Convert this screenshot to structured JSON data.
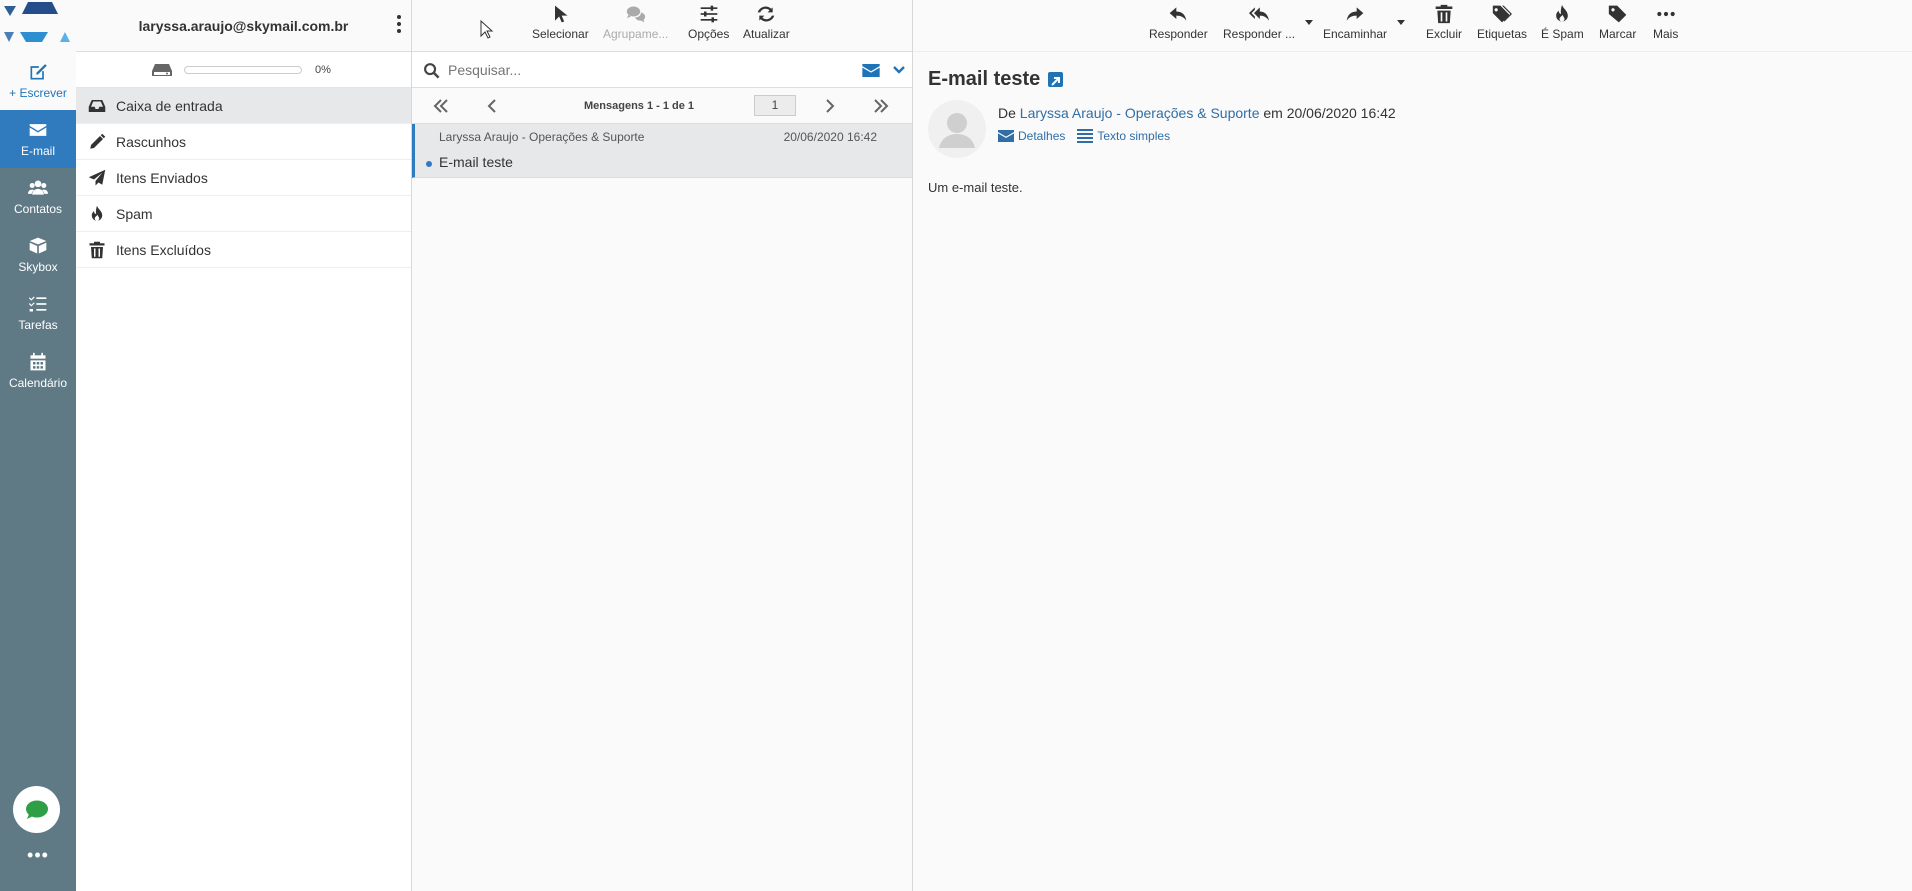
{
  "account": {
    "email": "laryssa.araujo@skymail.com.br"
  },
  "quota": {
    "percent_label": "0%",
    "fill": 0
  },
  "nav": {
    "compose_label": "+ Escrever",
    "items": [
      {
        "label": "E-mail",
        "icon": "envelope-icon"
      },
      {
        "label": "Contatos",
        "icon": "users-icon"
      },
      {
        "label": "Skybox",
        "icon": "box-icon"
      },
      {
        "label": "Tarefas",
        "icon": "tasks-icon"
      },
      {
        "label": "Calendário",
        "icon": "calendar-icon"
      }
    ],
    "more_label": "•••"
  },
  "folders": [
    {
      "label": "Caixa de entrada",
      "icon": "inbox-icon"
    },
    {
      "label": "Rascunhos",
      "icon": "pencil-icon"
    },
    {
      "label": "Itens Enviados",
      "icon": "paper-plane-icon"
    },
    {
      "label": "Spam",
      "icon": "fire-icon"
    },
    {
      "label": "Itens Excluídos",
      "icon": "trash-icon"
    }
  ],
  "list_toolbar": {
    "select": "Selecionar",
    "group": "Agrupame...",
    "options": "Opções",
    "refresh": "Atualizar"
  },
  "search": {
    "placeholder": "Pesquisar..."
  },
  "pager": {
    "summary": "Mensagens 1 - 1 de 1",
    "page": "1"
  },
  "messages": [
    {
      "from": "Laryssa Araujo - Operações & Suporte",
      "date": "20/06/2020 16:42",
      "subject": "E-mail teste"
    }
  ],
  "message_toolbar": {
    "reply": "Responder",
    "reply_all": "Responder ...",
    "forward": "Encaminhar",
    "delete": "Excluir",
    "labels": "Etiquetas",
    "spam": "É Spam",
    "mark": "Marcar",
    "more": "Mais"
  },
  "reading": {
    "subject": "E-mail teste",
    "from_prefix": "De",
    "from_name": "Laryssa Araujo - Operações & Suporte",
    "on_text": "em 20/06/2020 16:42",
    "details": "Detalhes",
    "plain_text": "Texto simples",
    "body": "Um e-mail teste."
  },
  "colors": {
    "nav_bg": "#5f7985",
    "accent": "#2f7bbd",
    "link": "#2f6ea7"
  }
}
